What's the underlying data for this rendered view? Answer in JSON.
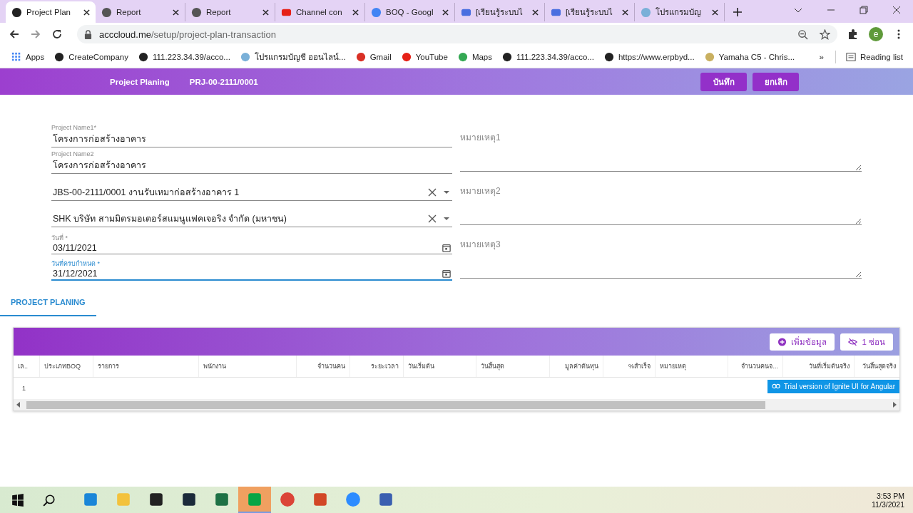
{
  "browser": {
    "tabs": [
      {
        "title": "Project Plan",
        "kind": "angular",
        "selected": true
      },
      {
        "title": "Report",
        "kind": "globe",
        "selected": false
      },
      {
        "title": "Report",
        "kind": "globe",
        "selected": false
      },
      {
        "title": "Channel con",
        "kind": "youtube",
        "selected": false
      },
      {
        "title": "BOQ - Googl",
        "kind": "google",
        "selected": false
      },
      {
        "title": "[เรียนรู้ระบบไ",
        "kind": "b",
        "selected": false
      },
      {
        "title": "[เรียนรู้ระบบไ",
        "kind": "b",
        "selected": false
      },
      {
        "title": "โปรแกรมบัญ",
        "kind": "cloud",
        "selected": false
      }
    ],
    "url_host": "acccloud.me",
    "url_path": "/setup/project-plan-transaction",
    "profile": "e",
    "bookmarks": [
      {
        "label": "Apps",
        "kind": "apps"
      },
      {
        "label": "CreateCompany",
        "kind": "globe"
      },
      {
        "label": "111.223.34.39/acco...",
        "kind": "globe"
      },
      {
        "label": "โปรแกรมบัญชี ออนไลน์...",
        "kind": "cloud"
      },
      {
        "label": "Gmail",
        "kind": "gmail"
      },
      {
        "label": "YouTube",
        "kind": "youtube"
      },
      {
        "label": "Maps",
        "kind": "maps"
      },
      {
        "label": "111.223.34.39/acco...",
        "kind": "globe"
      },
      {
        "label": "https://www.erpbyd...",
        "kind": "globe"
      },
      {
        "label": "Yamaha C5 - Chris...",
        "kind": "v"
      }
    ],
    "more": "»",
    "reading_list": "Reading list"
  },
  "header": {
    "title": "Project Planing",
    "code": "PRJ-00-2111/0001",
    "buttons": [
      "บันทึก",
      "ยกเลิก"
    ]
  },
  "form": {
    "fields": [
      {
        "kind": "text",
        "label": "Project Name1*",
        "value": "โครงการก่อสร้างอาคาร",
        "focused": false
      },
      {
        "kind": "text",
        "label": "Project Name2",
        "value": "โครงการก่อสร้างอาคาร",
        "focused": false
      },
      {
        "kind": "select",
        "value": "JBS-00-2111/0001 งานรับเหมาก่อสร้างอาคาร 1",
        "focused": false
      },
      {
        "kind": "select",
        "value": "SHK บริษัท สามมิตรมอเตอร์สแมนูแฟคเจอริง จำกัด (มหาชน)",
        "focused": false
      },
      {
        "kind": "date",
        "label": "วันที่ *",
        "value": "03/11/2021",
        "focused": false
      },
      {
        "kind": "date",
        "label": "วันที่ครบกำหนด *",
        "value": "31/12/2021",
        "focused": true
      }
    ],
    "remarks": [
      {
        "placeholder": "หมายเหตุ1"
      },
      {
        "placeholder": "หมายเหตุ2"
      },
      {
        "placeholder": "หมายเหตุ3"
      }
    ]
  },
  "section_tab": {
    "label": "PROJECT PLANING",
    "selected": true
  },
  "grid": {
    "add_button": "เพิ่มข้อมูล",
    "hide_button": "1 ซ่อน",
    "columns": [
      "เล..",
      "ประเภทBOQ",
      "รายการ",
      "พนักงาน",
      "จำนวนคน",
      "ระยะเวลา",
      "วันเริ่มต้น",
      "วันสิ้นสุด",
      "มูลค่าต้นทุน",
      "%สำเร็จ",
      "หมายเหตุ",
      "จำนวนคนจ...",
      "วันที่เริ่มต้นจริง",
      "วันสิ้นสุดจริง"
    ],
    "rows": [
      [
        "1"
      ]
    ],
    "trial": "Trial version of Ignite UI for Angular"
  },
  "taskbar": {
    "apps": [
      {
        "kind": "mail",
        "selected": false
      },
      {
        "kind": "folder",
        "selected": false
      },
      {
        "kind": "notes",
        "selected": false
      },
      {
        "kind": "webex",
        "selected": false
      },
      {
        "kind": "excel",
        "selected": false
      },
      {
        "kind": "line",
        "selected": true
      },
      {
        "kind": "chrome",
        "selected": false
      },
      {
        "kind": "powerpoint",
        "selected": false
      },
      {
        "kind": "zoom",
        "selected": false
      },
      {
        "kind": "network",
        "selected": false
      }
    ],
    "time": "3:53 PM",
    "date": "11/3/2021"
  }
}
